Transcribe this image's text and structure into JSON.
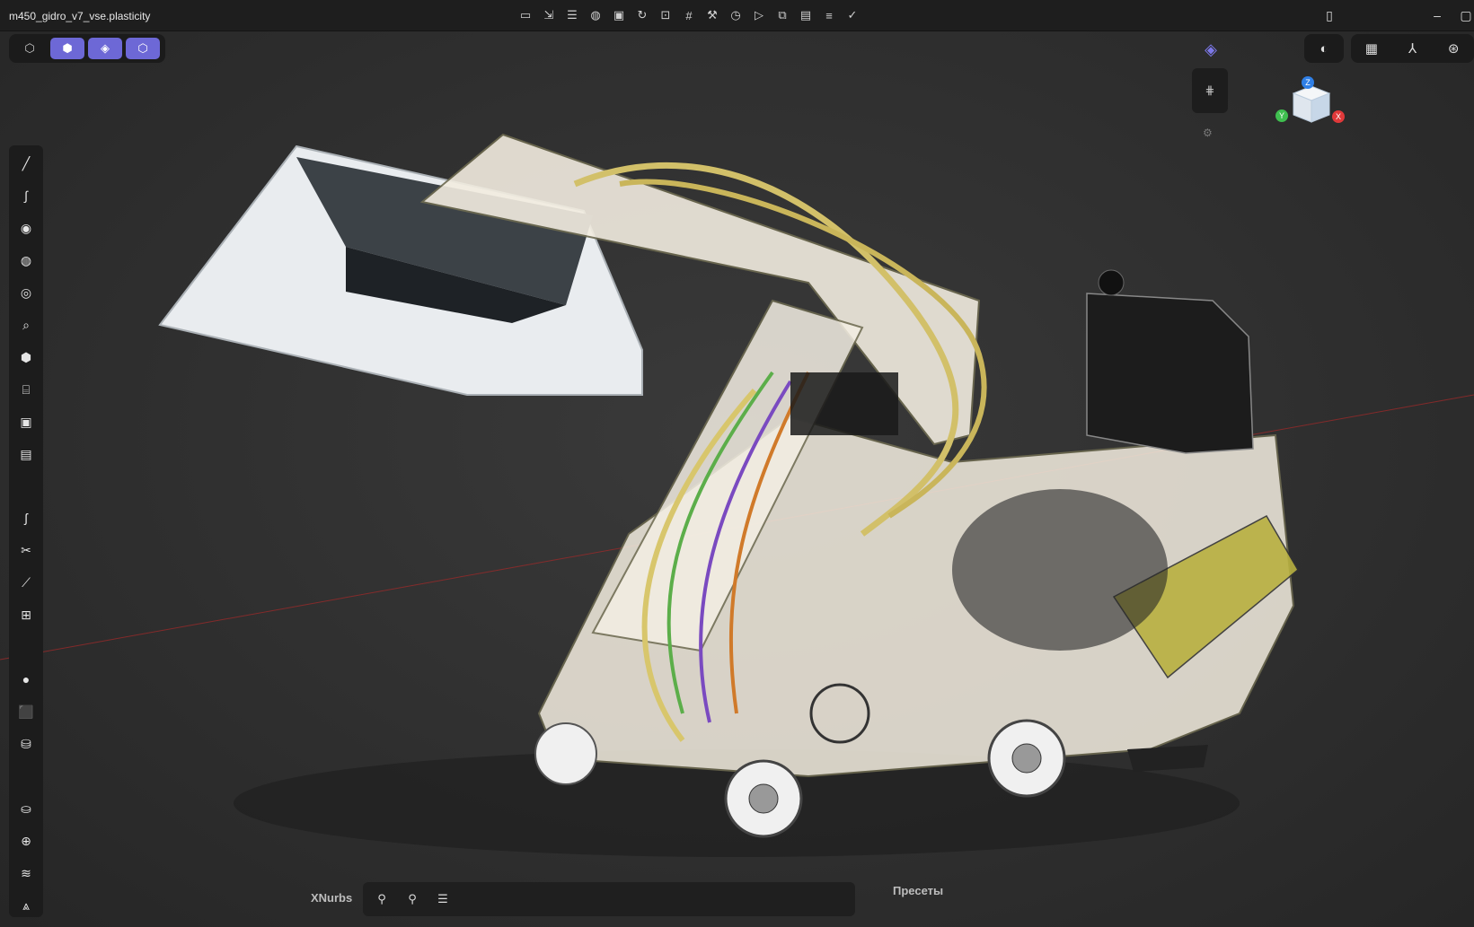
{
  "window": {
    "file_name": "m450_gidro_v7_vse.plasticity"
  },
  "top_toolbar": {
    "icons": [
      "folder-icon",
      "import-icon",
      "layers-icon",
      "globe-icon",
      "save-icon",
      "refresh-icon",
      "lock-icon",
      "grid-icon",
      "tools-icon",
      "clock-icon",
      "play-icon",
      "presentation-icon",
      "image-icon",
      "list-icon",
      "check-icon"
    ]
  },
  "mode_group": {
    "items": [
      {
        "icon": "object-mode-icon",
        "glyph": "⬡"
      },
      {
        "icon": "vertex-mode-icon",
        "glyph": "⬢"
      },
      {
        "icon": "face-mode-icon",
        "glyph": "◈"
      },
      {
        "icon": "solid-mode-icon",
        "glyph": "⬡"
      }
    ]
  },
  "left_toolbar": {
    "tools": [
      {
        "name": "line-tool-icon",
        "glyph": "╱"
      },
      {
        "name": "curve-tool-icon",
        "glyph": "∫"
      },
      {
        "name": "circle-tool-icon",
        "glyph": "◉"
      },
      {
        "name": "sphere-tool-icon",
        "glyph": "◍"
      },
      {
        "name": "arc-tool-icon",
        "glyph": "◎"
      },
      {
        "name": "magnify-tool-icon",
        "glyph": "⌕"
      },
      {
        "name": "polygon-tool-icon",
        "glyph": "⬢"
      },
      {
        "name": "cylinder-tool-icon",
        "glyph": "⌸"
      },
      {
        "name": "square-tool-icon",
        "glyph": "▣"
      },
      {
        "name": "rectangle-tool-icon",
        "glyph": "▤"
      },
      {
        "name": "spline-tool-icon",
        "glyph": "ʃ"
      },
      {
        "name": "trim-tool-icon",
        "glyph": "✂"
      },
      {
        "name": "brush-tool-icon",
        "glyph": "⟋"
      },
      {
        "name": "transform-tool-icon",
        "glyph": "⊞"
      },
      {
        "name": "sphere-primitive-icon",
        "glyph": "●"
      },
      {
        "name": "box-primitive-icon",
        "glyph": "⬛"
      },
      {
        "name": "cylinder-primitive-icon",
        "glyph": "⛁"
      },
      {
        "name": "fillet-tool-icon",
        "glyph": "⛀"
      },
      {
        "name": "boolean-tool-icon",
        "glyph": "⊕"
      },
      {
        "name": "sweep-tool-icon",
        "glyph": "≋"
      },
      {
        "name": "loft-tool-icon",
        "glyph": "⩓"
      }
    ]
  },
  "right_controls": {
    "render_toggle": "◐",
    "view_buttons": [
      "▦",
      "⅄",
      "⊛"
    ]
  },
  "view_cube": {
    "z_label": "Z",
    "y_label": "Y",
    "x_label": "X"
  },
  "bottom_bar": {
    "left_label": "XNurbs",
    "right_label": "Пресеты",
    "icons": [
      "snap-icon",
      "snap-alt-icon",
      "list-stack-icon"
    ]
  },
  "colors": {
    "accent": "#6d68d6",
    "axis_x": "#e0393a",
    "axis_y": "#3fbf4f",
    "axis_z": "#2f7fe6",
    "bg": "#2e2e2e"
  }
}
